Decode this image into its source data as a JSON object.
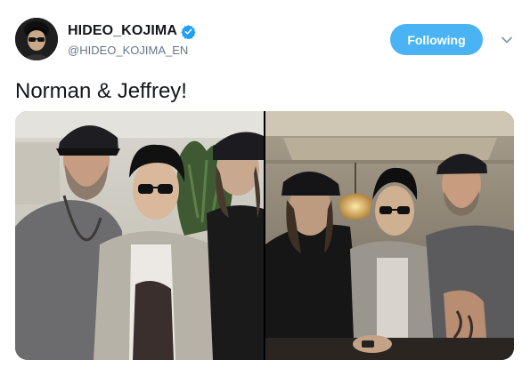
{
  "user": {
    "display_name": "HIDEO_KOJIMA",
    "handle": "@HIDEO_KOJIMA_EN",
    "verified": true
  },
  "follow_button": {
    "label": "Following"
  },
  "tweet": {
    "text": "Norman & Jeffrey!"
  },
  "colors": {
    "accent": "#4ab3f4",
    "name_text": "#14171a",
    "handle_text": "#657786",
    "verified_badge": "#1da1f2"
  },
  "icons": {
    "verified": "verified-badge-icon",
    "menu": "chevron-down-icon"
  }
}
